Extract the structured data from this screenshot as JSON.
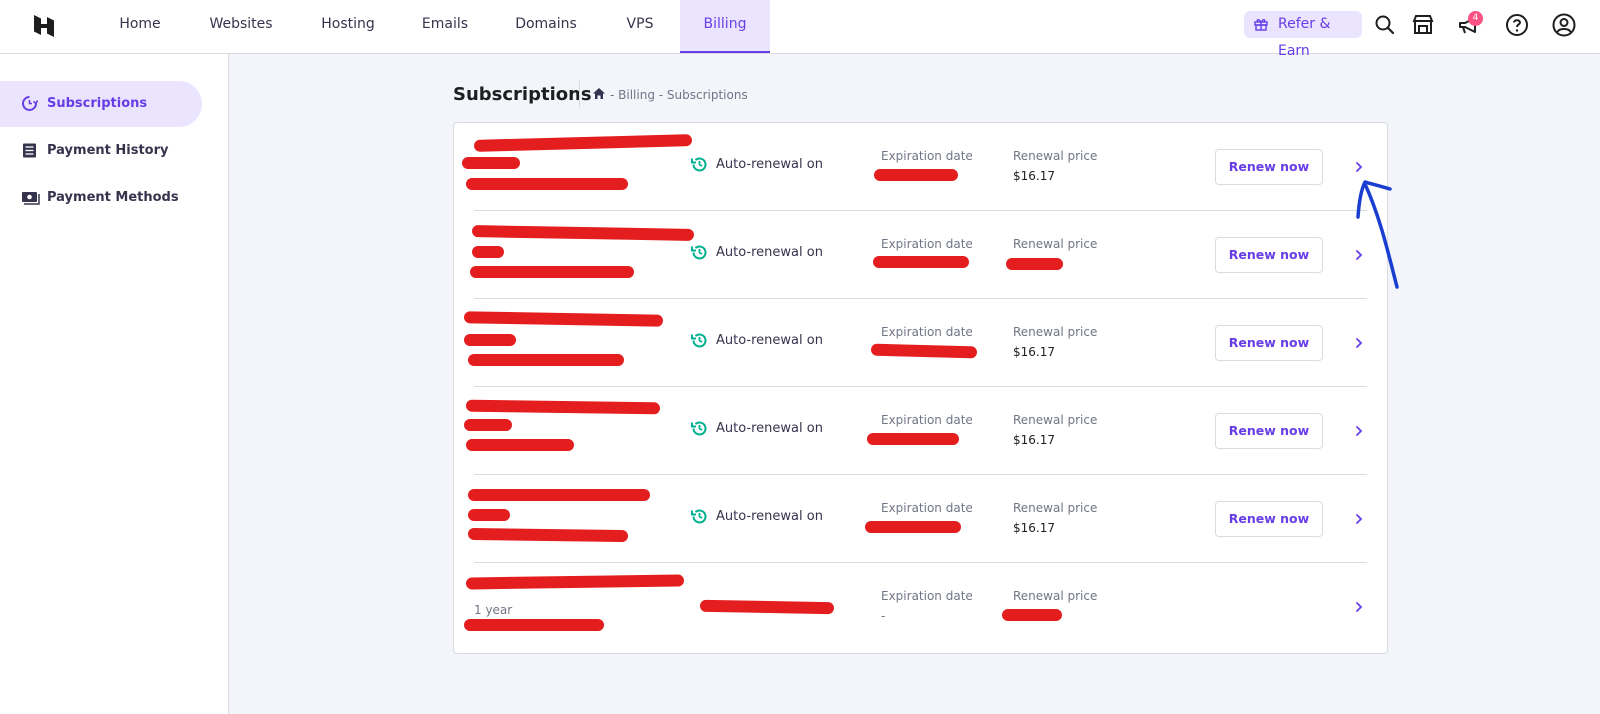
{
  "nav": {
    "items": [
      "Home",
      "Websites",
      "Hosting",
      "Emails",
      "Domains",
      "VPS",
      "Billing"
    ],
    "active": "Billing",
    "refer_label": "Refer & Earn",
    "notification_count": "4"
  },
  "sidebar": {
    "items": [
      {
        "label": "Subscriptions",
        "icon": "subscriptions-icon",
        "active": true
      },
      {
        "label": "Payment History",
        "icon": "payment-history-icon",
        "active": false
      },
      {
        "label": "Payment Methods",
        "icon": "payment-methods-icon",
        "active": false
      }
    ]
  },
  "page": {
    "title": "Subscriptions",
    "breadcrumb": "- Billing - Subscriptions"
  },
  "subscriptions": [
    {
      "auto_renewal": "Auto-renewal on",
      "expiration_label": "Expiration date",
      "renewal_label": "Renewal price",
      "renewal_price": "$16.17",
      "button": "Renew now"
    },
    {
      "auto_renewal": "Auto-renewal on",
      "expiration_label": "Expiration date",
      "renewal_label": "Renewal price",
      "renewal_price": "",
      "button": "Renew now"
    },
    {
      "auto_renewal": "Auto-renewal on",
      "expiration_label": "Expiration date",
      "renewal_label": "Renewal price",
      "renewal_price": "$16.17",
      "button": "Renew now"
    },
    {
      "auto_renewal": "Auto-renewal on",
      "expiration_label": "Expiration date",
      "renewal_label": "Renewal price",
      "renewal_price": "$16.17",
      "button": "Renew now"
    },
    {
      "auto_renewal": "Auto-renewal on",
      "expiration_label": "Expiration date",
      "renewal_label": "Renewal price",
      "renewal_price": "$16.17",
      "button": "Renew now"
    },
    {
      "plan_period": "1 year",
      "expiration_label": "Expiration date",
      "expiration_value": "-",
      "renewal_label": "Renewal price"
    }
  ],
  "colors": {
    "accent": "#673de6",
    "accent_light": "#ebe4ff",
    "renewal_green": "#00b090",
    "redaction": "#e41e1e",
    "annotation_arrow": "#1a3fd0"
  }
}
